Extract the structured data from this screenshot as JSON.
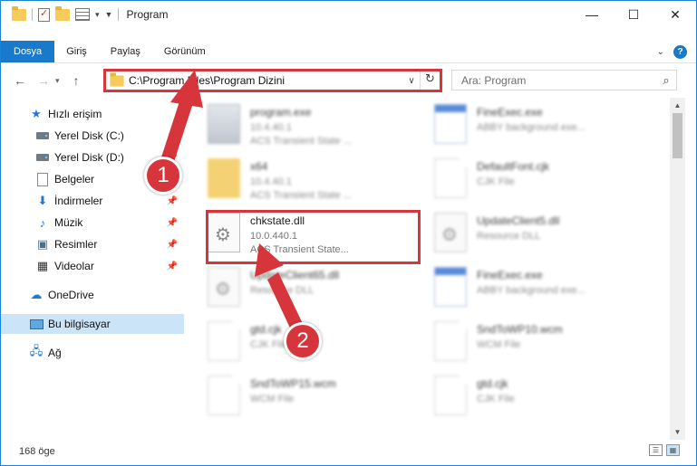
{
  "window": {
    "title": "Program",
    "min": "—",
    "max": "☐",
    "close": "✕"
  },
  "ribbon": {
    "tabs": [
      "Dosya",
      "Giriş",
      "Paylaş",
      "Görünüm"
    ],
    "help": "?"
  },
  "address": {
    "path": "C:\\Program Files\\Program Dizini"
  },
  "search": {
    "placeholder": "Ara: Program"
  },
  "nav": {
    "back": "←",
    "forward": "→",
    "up": "↑",
    "items": [
      "Hızlı erişim",
      "Yerel Disk (C:)",
      "Yerel Disk (D:)",
      "Belgeler",
      "İndirmeler",
      "Müzik",
      "Resimler",
      "Videolar",
      "OneDrive",
      "Bu bilgisayar",
      "Ağ"
    ]
  },
  "files": [
    {
      "name": "program.exe",
      "line2": "10.4.40.1",
      "line3": "ACS Transient State ..."
    },
    {
      "name": "FineExec.exe",
      "line2": "ABBY background exe...",
      "line3": ""
    },
    {
      "name": "x64",
      "line2": "10.4.40.1",
      "line3": "ACS Transient State ..."
    },
    {
      "name": "DefaultFont.cjk",
      "line2": "CJK File",
      "line3": ""
    },
    {
      "name": "chkstate.dll",
      "line2": "10.0.440.1",
      "line3": "ACS Transient State..."
    },
    {
      "name": "UpdateClient5.dll",
      "line2": "Resource DLL",
      "line3": ""
    },
    {
      "name": "UpdateClient65.dll",
      "line2": "Resource DLL",
      "line3": ""
    },
    {
      "name": "FineExec.exe",
      "line2": "ABBY background exe...",
      "line3": ""
    },
    {
      "name": "gtd.cjk",
      "line2": "CJK File",
      "line3": ""
    },
    {
      "name": "SndToWP10.wcm",
      "line2": "WCM File",
      "line3": ""
    },
    {
      "name": "SndToWP15.wcm",
      "line2": "WCM File",
      "line3": ""
    },
    {
      "name": "gtd.cjk",
      "line2": "CJK File",
      "line3": ""
    }
  ],
  "status": {
    "count": "168 öge"
  },
  "annotations": {
    "step1": "1",
    "step2": "2",
    "color": "#d6363b"
  }
}
